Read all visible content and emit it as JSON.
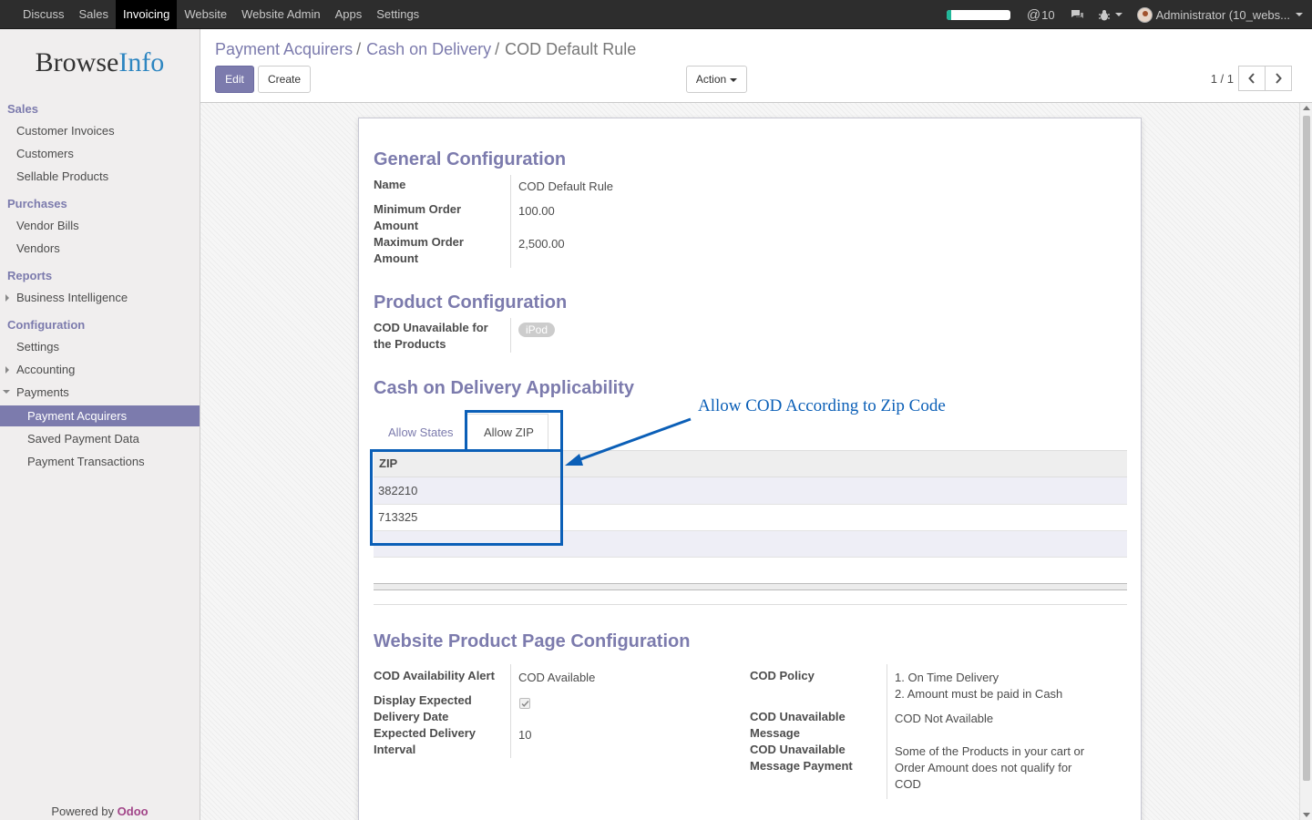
{
  "topbar": {
    "menu": [
      "Discuss",
      "Sales",
      "Invoicing",
      "Website",
      "Website Admin",
      "Apps",
      "Settings"
    ],
    "active_menu": "Invoicing",
    "progress_fraction": 0.07,
    "mentions_count": "10",
    "user": "Administrator (10_webs..."
  },
  "sidebar": {
    "logo_main": "Browse",
    "logo_accent": "Info",
    "sections": {
      "sales": "Sales",
      "purchases": "Purchases",
      "reports": "Reports",
      "configuration": "Configuration"
    },
    "items": {
      "customer_invoices": "Customer Invoices",
      "customers": "Customers",
      "sellable_products": "Sellable Products",
      "vendor_bills": "Vendor Bills",
      "vendors": "Vendors",
      "business_intelligence": "Business Intelligence",
      "settings": "Settings",
      "accounting": "Accounting",
      "payments": "Payments",
      "payment_acquirers": "Payment Acquirers",
      "saved_payment_data": "Saved Payment Data",
      "payment_transactions": "Payment Transactions"
    },
    "powered_by": "Powered by",
    "powered_brand": "Odoo"
  },
  "control": {
    "breadcrumb": [
      "Payment Acquirers",
      "Cash on Delivery",
      "COD Default Rule"
    ],
    "separator": "/",
    "edit": "Edit",
    "create": "Create",
    "action": "Action",
    "pager": "1 / 1"
  },
  "form": {
    "general": {
      "title": "General Configuration",
      "name_label": "Name",
      "name_value": "COD Default Rule",
      "min_label": "Minimum Order Amount",
      "min_value": "100.00",
      "max_label": "Maximum Order Amount",
      "max_value": "2,500.00"
    },
    "product": {
      "title": "Product Configuration",
      "unavailable_label": "COD Unavailable for the Products",
      "tag": "iPod"
    },
    "applicability": {
      "title": "Cash on Delivery Applicability",
      "tab_states": "Allow States",
      "tab_zip": "Allow ZIP",
      "column": "ZIP",
      "rows": [
        "382210",
        "713325"
      ]
    },
    "annotation": "Allow COD According to Zip Code",
    "website": {
      "title": "Website Product Page Configuration",
      "alert_label": "COD Availability Alert",
      "alert_value": "COD Available",
      "display_label": "Display Expected Delivery Date",
      "display_checked": true,
      "interval_label": "Expected Delivery Interval",
      "interval_value": "10",
      "policy_label": "COD Policy",
      "policy_line1": "1. On Time Delivery",
      "policy_line2": "2. Amount must be paid in Cash",
      "unavail_msg_label": "COD Unavailable Message",
      "unavail_msg_value": "COD Not Available",
      "unavail_pay_label": "COD Unavailable Message Payment",
      "unavail_pay_value": "Some of the Products in your cart or Order Amount does not qualify for COD"
    }
  },
  "colors": {
    "accent": "#7c7bad",
    "annotation": "#0b5fb7",
    "topbar": "#2d2d2d"
  }
}
